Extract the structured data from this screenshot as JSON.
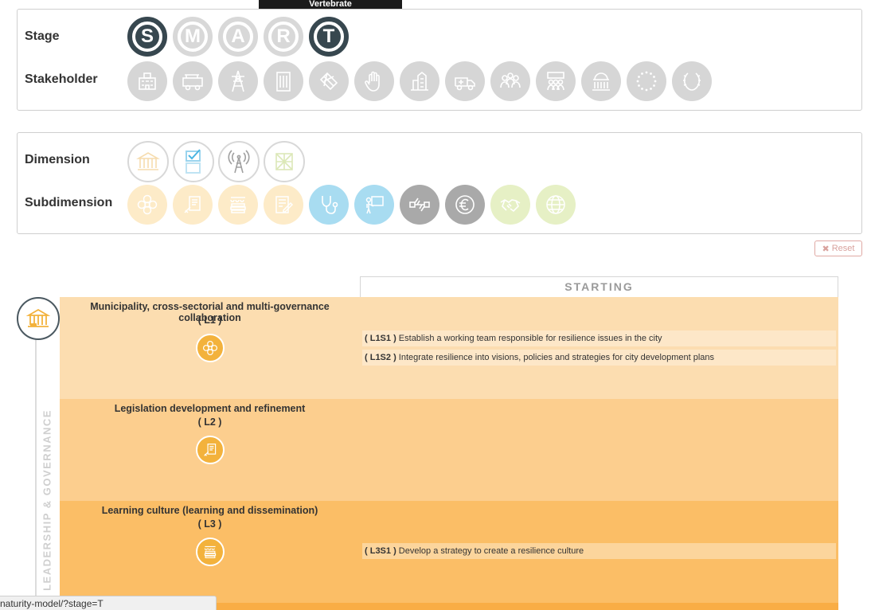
{
  "tooltip": {
    "text": "Vertebrate"
  },
  "filters": {
    "stage": {
      "label": "Stage",
      "letters": [
        "S",
        "M",
        "A",
        "R",
        "T"
      ],
      "active": [
        "S",
        "T"
      ]
    },
    "stakeholder": {
      "label": "Stakeholder",
      "icons": [
        "city-hall-icon",
        "fire-truck-icon",
        "power-tower-icon",
        "building-icon",
        "map-icon",
        "hand-icon",
        "town-icon",
        "ambulance-icon",
        "community-group-icon",
        "citizens-icon",
        "parliament-icon",
        "eu-stars-icon",
        "laurel-icon"
      ]
    },
    "dimension": {
      "label": "Dimension",
      "icons": [
        "governance-building-icon",
        "checklist-icon",
        "antenna-tower-icon",
        "network-map-icon"
      ]
    },
    "subdimension": {
      "label": "Subdimension",
      "icons": [
        {
          "name": "flower-icon",
          "color": "#fdebc8"
        },
        {
          "name": "legislation-icon",
          "color": "#fdebc8"
        },
        {
          "name": "learning-icon",
          "color": "#fdebc8"
        },
        {
          "name": "document-edit-icon",
          "color": "#fdebc8"
        },
        {
          "name": "stethoscope-icon",
          "color": "#a8dcf1"
        },
        {
          "name": "teaching-board-icon",
          "color": "#a8dcf1"
        },
        {
          "name": "connected-nodes-icon",
          "color": "#a9a9a9"
        },
        {
          "name": "euro-icon",
          "color": "#a9a9a9"
        },
        {
          "name": "handshake-icon",
          "color": "#e6f0c5"
        },
        {
          "name": "globe-network-icon",
          "color": "#e6f0c5"
        }
      ]
    }
  },
  "reset": {
    "label": "Reset"
  },
  "column_header": "STARTING",
  "pillar": {
    "label": "LEADERSHIP & GOVERNANCE",
    "icon": "governance-building-icon"
  },
  "sections": [
    {
      "title": "Municipality, cross-sectorial and multi-governance collaboration",
      "code": "( L1 )",
      "icon": "flower-icon",
      "bg": "#fcddb0",
      "items": [
        {
          "code": "( L1S1 )",
          "text": "Establish a working team responsible for resilience issues in the city"
        },
        {
          "code": "( L1S2 )",
          "text": "Integrate resilience into visions, policies and strategies for city development plans"
        }
      ]
    },
    {
      "title": "Legislation development and refinement",
      "code": "( L2 )",
      "icon": "legislation-icon",
      "bg": "#fcce8e",
      "items": []
    },
    {
      "title": "Learning culture (learning and dissemination)",
      "code": "( L3 )",
      "icon": "learning-icon",
      "bg": "#fbbe66",
      "items": [
        {
          "code": "( L3S1 )",
          "text": "Develop a strategy to create a resilience culture"
        }
      ]
    }
  ],
  "status_bar": {
    "url": "naturity-model/?stage=T"
  }
}
